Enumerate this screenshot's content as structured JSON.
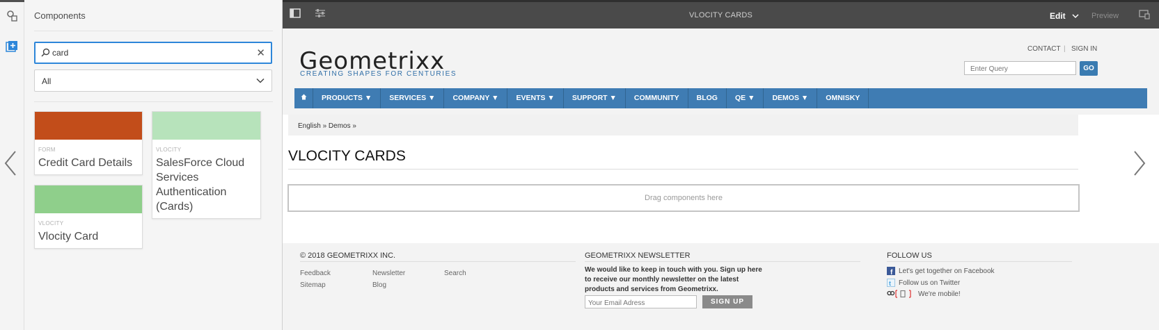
{
  "colors": {
    "accent": "#2d86d9",
    "topbar": "#4a4a4a",
    "nav": "#3f7cb3",
    "swatch_credit": "#c24d1a",
    "swatch_salesforce": "#b7e3bb",
    "swatch_vlocity": "#8fcf8b"
  },
  "panel": {
    "title": "Components",
    "search": {
      "value": "card"
    },
    "filter": {
      "selected": "All"
    },
    "cards": [
      {
        "group": "FORM",
        "name": "Credit Card Details"
      },
      {
        "group": "VLOCITY",
        "name": "SalesForce Cloud Services Authentication (Cards)"
      },
      {
        "group": "VLOCITY",
        "name": "Vlocity Card"
      }
    ]
  },
  "topbar": {
    "title": "VLOCITY CARDS",
    "mode": "Edit",
    "preview": "Preview"
  },
  "site": {
    "logo": "Geometrixx",
    "tagline": "CREATING SHAPES FOR CENTURIES",
    "contact": "CONTACT",
    "separator": "|",
    "signin": "SIGN IN",
    "query_placeholder": "Enter Query",
    "go": "GO",
    "nav": [
      {
        "label": "PRODUCTS ▼"
      },
      {
        "label": "SERVICES ▼"
      },
      {
        "label": "COMPANY ▼"
      },
      {
        "label": "EVENTS ▼"
      },
      {
        "label": "SUPPORT ▼"
      },
      {
        "label": "COMMUNITY"
      },
      {
        "label": "BLOG"
      },
      {
        "label": "QE ▼"
      },
      {
        "label": "DEMOS ▼"
      },
      {
        "label": "OMNISKY"
      }
    ],
    "breadcrumb": "English » Demos »",
    "page_title": "VLOCITY CARDS",
    "drop_zone": "Drag components here",
    "footer": {
      "copyright": "© 2018 GEOMETRIXX INC.",
      "links": [
        "Feedback",
        "Newsletter",
        "Search",
        "Sitemap",
        "Blog"
      ],
      "newsletter_title": "GEOMETRIXX NEWSLETTER",
      "newsletter_text": "We would like to keep in touch with you. Sign up here to receive our monthly newsletter on the latest products and services from Geometrixx.",
      "email_placeholder": "Your Email Adress",
      "signup": "SIGN UP",
      "follow_title": "FOLLOW US",
      "facebook": "Let's get together on Facebook",
      "twitter": "Follow us on Twitter",
      "mobile": "We're mobile!"
    }
  }
}
